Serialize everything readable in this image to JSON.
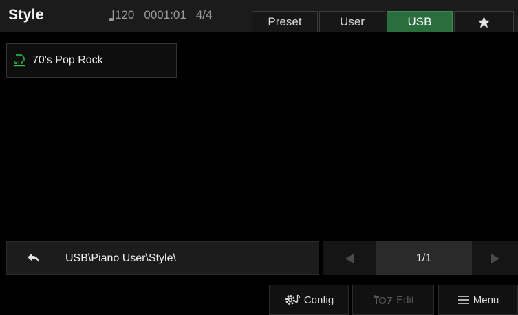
{
  "header": {
    "title": "Style",
    "tempo": "120",
    "position": "0001:01",
    "time_signature": "4/4",
    "tabs": [
      {
        "label": "Preset",
        "active": false
      },
      {
        "label": "User",
        "active": false
      },
      {
        "label": "USB",
        "active": true
      },
      {
        "label": "",
        "icon": "star-icon",
        "active": false
      }
    ]
  },
  "files": [
    {
      "label": "70's Pop Rock",
      "icon": "sty-file-icon",
      "icon_text": "STY"
    }
  ],
  "pathbar": {
    "back_icon": "back-arrow-icon",
    "path": "USB\\Piano User\\Style\\"
  },
  "pager": {
    "page": "1/1",
    "prev_icon": "triangle-left-icon",
    "next_icon": "triangle-right-icon"
  },
  "footer": {
    "config_label": "Config",
    "edit_label": "Edit",
    "menu_label": "Menu"
  },
  "colors": {
    "accent_green": "#2a6e3d",
    "icon_green": "#35c24a"
  }
}
